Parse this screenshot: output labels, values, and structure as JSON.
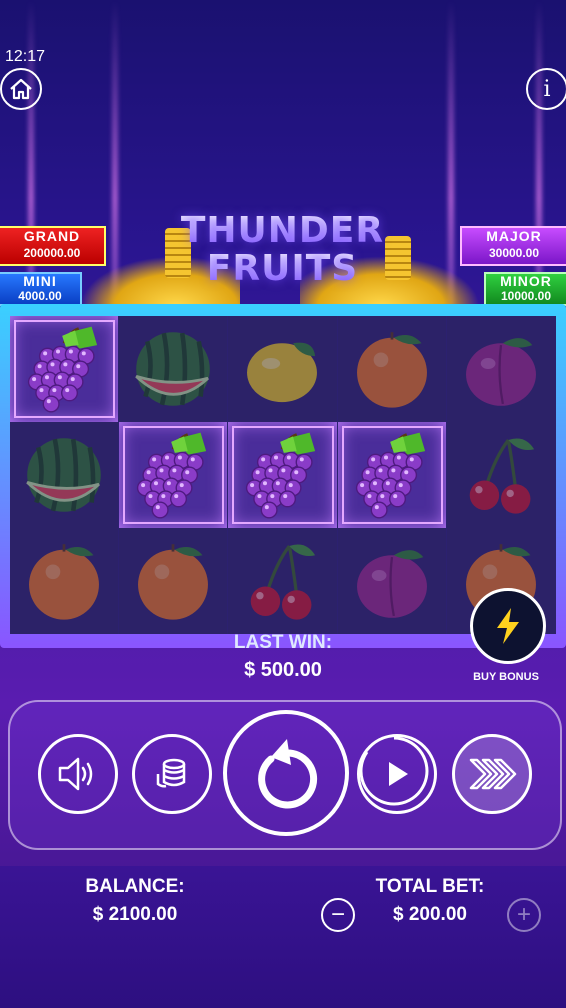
{
  "status": {
    "time": "12:17"
  },
  "title": {
    "line1": "THUNDER",
    "line2": "FRUITS"
  },
  "jackpots": {
    "grand": {
      "name": "GRAND",
      "value": "200000.00"
    },
    "mini": {
      "name": "MINI",
      "value": "4000.00"
    },
    "major": {
      "name": "MAJOR",
      "value": "30000.00"
    },
    "minor": {
      "name": "MINOR",
      "value": "10000.00"
    }
  },
  "reels": [
    [
      "grapes",
      "watermelon",
      "orange"
    ],
    [
      "watermelon",
      "grapes",
      "orange"
    ],
    [
      "lemon",
      "grapes",
      "cherry"
    ],
    [
      "orange",
      "grapes",
      "plum"
    ],
    [
      "plum",
      "cherry",
      "orange"
    ]
  ],
  "winning_cells": [
    [
      0,
      0
    ],
    [
      1,
      1
    ],
    [
      2,
      1
    ],
    [
      3,
      1
    ]
  ],
  "last_win": {
    "label": "LAST WIN:",
    "value": "$ 500.00"
  },
  "buy_bonus": {
    "label": "BUY BONUS",
    "icon": "lightning-icon"
  },
  "controls": {
    "sound_icon": "speaker-icon",
    "bet_icon": "coin-stack-icon",
    "spin_icon": "spin-arrow-icon",
    "autoplay_icon": "play-icon",
    "turbo_icon": "fast-forward-icon"
  },
  "balance": {
    "label": "BALANCE:",
    "value": "$ 2100.00"
  },
  "total_bet": {
    "label": "TOTAL BET:",
    "value": "$ 200.00"
  },
  "colors": {
    "grand": "#d01010",
    "major": "#a030e0",
    "mini": "#1a5fe8",
    "minor": "#22b030"
  }
}
